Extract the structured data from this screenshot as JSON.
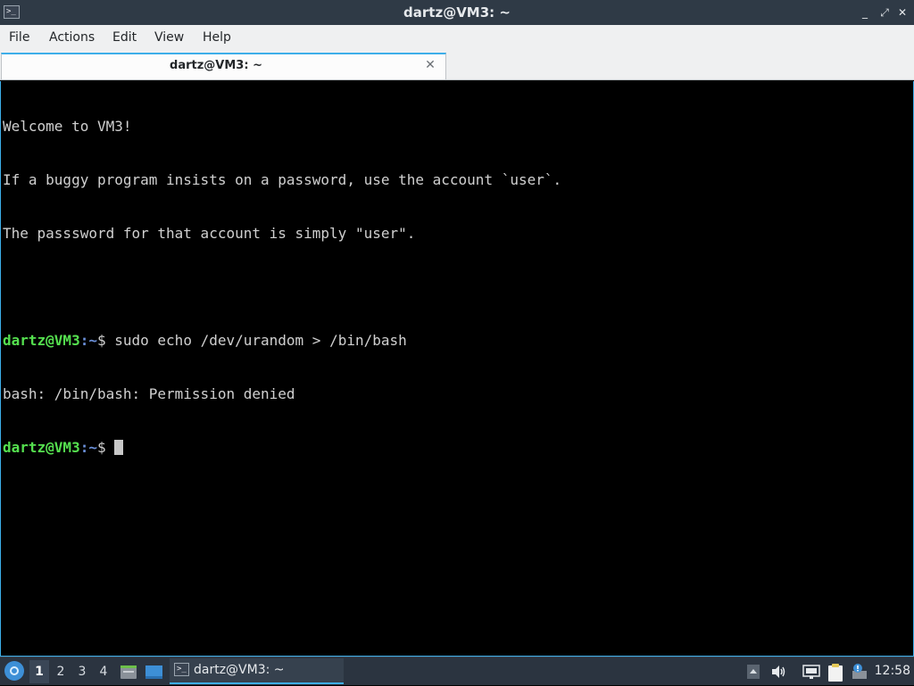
{
  "window": {
    "title": "dartz@VM3: ~",
    "app_icon_glyph": ">_",
    "controls": {
      "minimize": "_",
      "maximize": "⤢",
      "close": "✕"
    }
  },
  "menubar": {
    "items": [
      "File",
      "Actions",
      "Edit",
      "View",
      "Help"
    ]
  },
  "tabs": [
    {
      "label": "dartz@VM3: ~",
      "close": "✕"
    }
  ],
  "terminal": {
    "lines": [
      "Welcome to VM3!",
      "If a buggy program insists on a password, use the account `user`.",
      "The passsword for that account is simply \"user\"."
    ],
    "prompt_user": "dartz@VM3",
    "prompt_sep": ":",
    "prompt_path": "~",
    "prompt_symbol": "$ ",
    "command": "sudo echo /dev/urandom > /bin/bash",
    "output": "bash: /bin/bash: Permission denied"
  },
  "taskbar": {
    "workspaces": [
      "1",
      "2",
      "3",
      "4"
    ],
    "active_workspace": "1",
    "task_label": "dartz@VM3: ~",
    "clock": "12:58",
    "colors": {
      "accent": "#3daee9",
      "prompt_user": "#55e04f",
      "prompt_path": "#6a8fd8"
    }
  }
}
